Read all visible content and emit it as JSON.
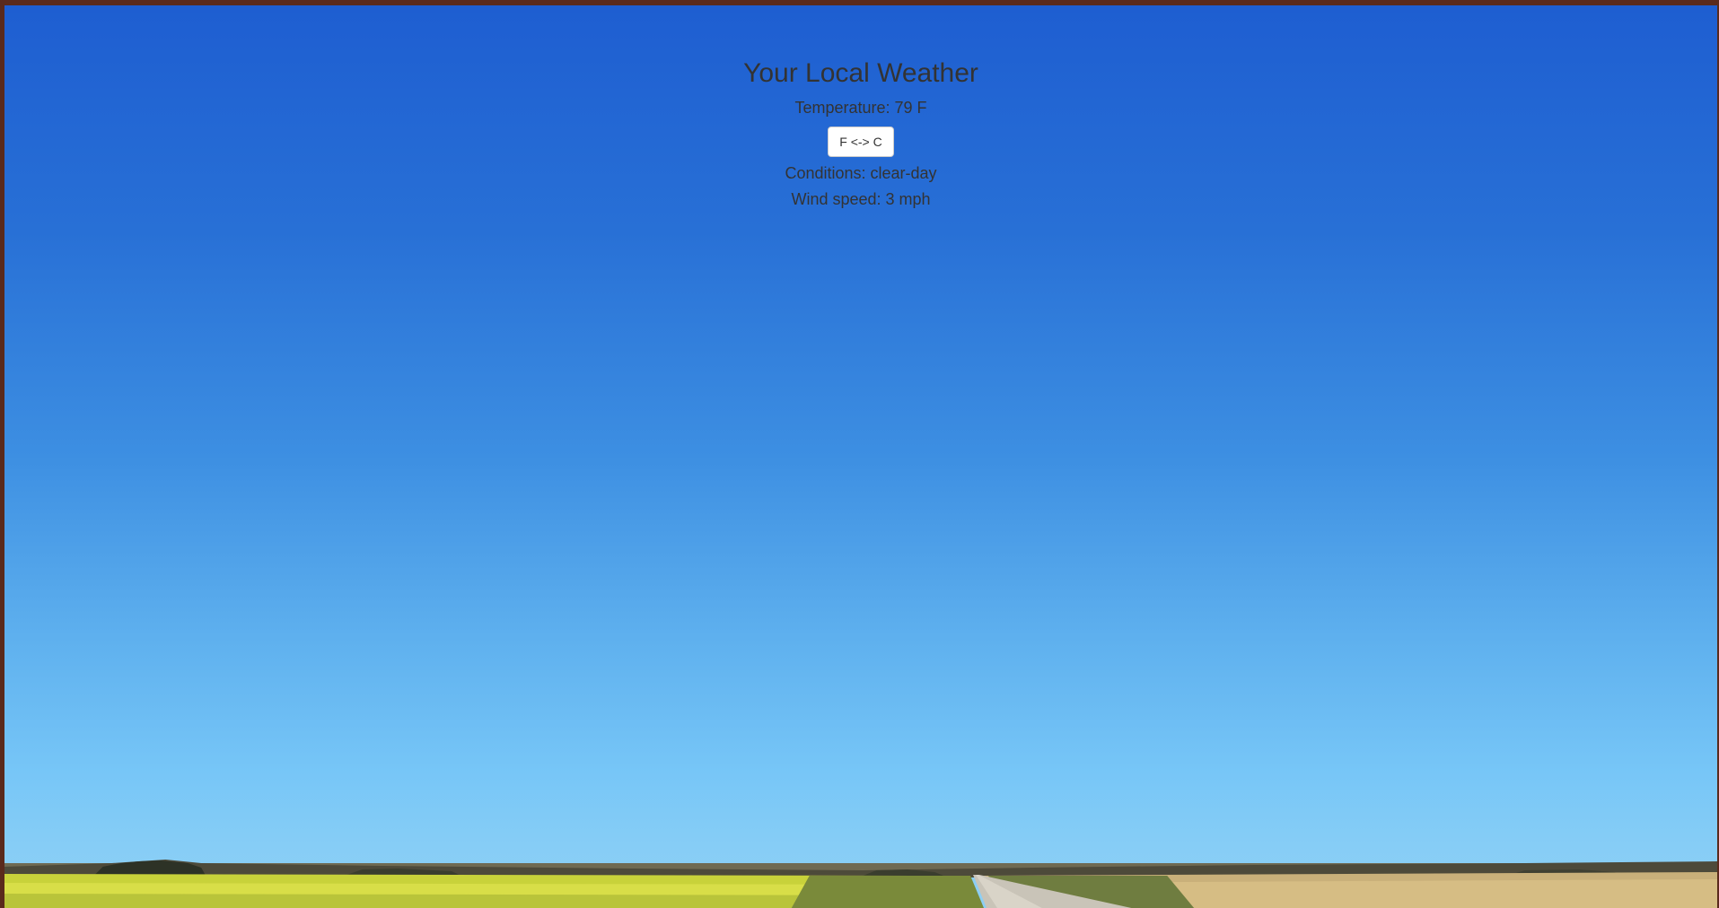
{
  "page": {
    "title": "Your Local Weather"
  },
  "weather": {
    "temperature_text": "Temperature: 79 F",
    "toggle_label": "F <-> C",
    "conditions_text": "Conditions: clear-day",
    "wind_text": "Wind speed: 3 mph"
  },
  "background": {
    "scene": "blue sky over prairie fields with a gravel road",
    "sky_top_color": "#1e5ed1",
    "sky_bottom_color": "#8fcff3",
    "frame_border_color": "#5a2a1c"
  }
}
